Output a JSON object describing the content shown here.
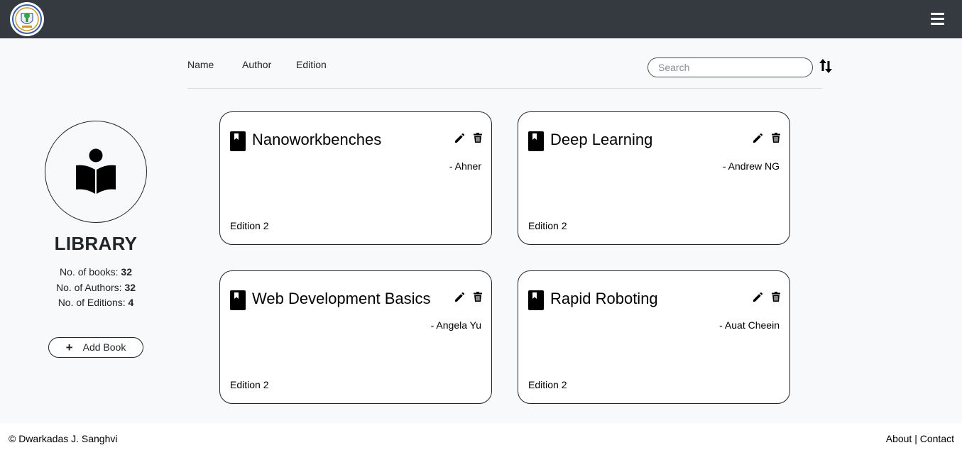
{
  "header": {
    "logo_icon": "college-crest-logo",
    "menu_icon": "hamburger-menu-icon"
  },
  "toolbar": {
    "sort_links": [
      "Name",
      "Author",
      "Edition"
    ],
    "search_placeholder": "Search",
    "search_value": "",
    "sort_icon": "sort-arrows-icon"
  },
  "sidebar": {
    "icon": "reader-book-icon",
    "title": "LIBRARY",
    "books_label": "No. of books:",
    "books_count": "32",
    "authors_label": "No. of Authors:",
    "authors_count": "32",
    "editions_label": "No. of Editions:",
    "editions_count": "4",
    "add_label": "Add Book"
  },
  "books": [
    {
      "title": "Nanoworkbenches",
      "author": "- Ahner",
      "edition": "Edition 2"
    },
    {
      "title": "Deep Learning",
      "author": "- Andrew NG",
      "edition": "Edition 2"
    },
    {
      "title": "Web Development Basics",
      "author": "- Angela Yu",
      "edition": "Edition 2"
    },
    {
      "title": "Rapid Roboting",
      "author": "- Auat Cheein",
      "edition": "Edition 2"
    }
  ],
  "footer": {
    "copyright": "© Dwarkadas J. Sanghvi",
    "about": "About",
    "separator": "|",
    "contact": "Contact"
  },
  "colors": {
    "navbar": "#343a40",
    "page_background": "#f8f9fa",
    "card_background": "#ffffff",
    "text": "#212529"
  }
}
